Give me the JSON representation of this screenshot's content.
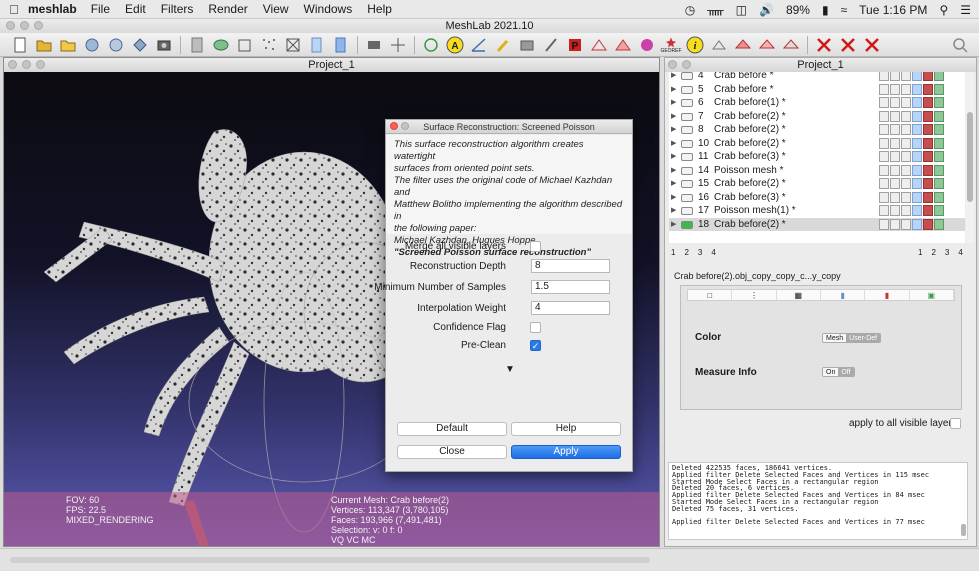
{
  "menubar": {
    "app_name": "meshlab",
    "menus": [
      "File",
      "Edit",
      "Filters",
      "Render",
      "View",
      "Windows",
      "Help"
    ],
    "battery": "89%",
    "clock": "Tue 1:16 PM"
  },
  "window": {
    "title": "MeshLab 2021.10"
  },
  "viewport": {
    "title": "Project_1",
    "fov": "FOV: 60",
    "fps": "FPS:   22.5",
    "render_mode": "MIXED_RENDERING",
    "current_mesh": "Current Mesh: Crab before(2)",
    "vertices": "Vertices: 113,347    (3,780,105)",
    "faces": "Faces: 193,966    (7,491,481)",
    "selection": "Selection: v: 0 f: 0",
    "flags": "VQ VC MC"
  },
  "dialog": {
    "title": "Surface Reconstruction: Screened Poisson",
    "desc_lines": [
      "This surface reconstruction algorithm creates watertight",
      "surfaces from oriented point sets.",
      "The filter uses the original code of Michael Kazhdan and",
      "Matthew Bolitho implementing the algorithm described in",
      "the following paper:",
      "Michael Kazhdan, Hugues Hoppe,"
    ],
    "desc_bold": "\"Screened Poisson surface reconstruction\"",
    "params": {
      "merge_label": "Merge all visible layers",
      "depth_label": "Reconstruction Depth",
      "depth_value": "8",
      "samples_label": "Minimum Number of Samples",
      "samples_value": "1.5",
      "weight_label": "Interpolation Weight",
      "weight_value": "4",
      "confidence_label": "Confidence Flag",
      "preclean_label": "Pre-Clean"
    },
    "expander": "▼",
    "buttons": {
      "default": "Default",
      "help": "Help",
      "close": "Close",
      "apply": "Apply"
    }
  },
  "layer_panel": {
    "title": "Project_1",
    "layers": [
      {
        "num": "4",
        "name": "Crab before *"
      },
      {
        "num": "5",
        "name": "Crab before *"
      },
      {
        "num": "6",
        "name": "Crab before(1) *"
      },
      {
        "num": "7",
        "name": "Crab before(2) *"
      },
      {
        "num": "8",
        "name": "Crab before(2) *"
      },
      {
        "num": "10",
        "name": "Crab before(2) *"
      },
      {
        "num": "11",
        "name": "Crab before(3) *"
      },
      {
        "num": "14",
        "name": "Poisson mesh *"
      },
      {
        "num": "15",
        "name": "Crab before(2) *"
      },
      {
        "num": "16",
        "name": "Crab before(3) *"
      },
      {
        "num": "17",
        "name": "Poisson mesh(1) *"
      },
      {
        "num": "18",
        "name": "Crab before(2) *"
      }
    ],
    "pages_left": [
      "1",
      "2",
      "3",
      "4"
    ],
    "pages_right": [
      "1",
      "2",
      "3",
      "4"
    ],
    "layer_full_name": "Crab before(2).obj_copy_copy_c...y_copy",
    "decor": {
      "color_label": "Color",
      "color_mesh": "Mesh",
      "color_userdef": "User-Def",
      "measure_label": "Measure Info",
      "measure_on": "On",
      "measure_off": "Off"
    },
    "apply_all_label": "apply to all visible layers",
    "log": [
      "Deleted 422535 faces, 186641 vertices.",
      "Applied filter Delete Selected Faces and Vertices in 115 msec",
      "Started Mode Select Faces in a rectangular region",
      "Deleted 20 faces, 6 vertices.",
      "Applied filter Delete Selected Faces and Vertices in 84 msec",
      "Started Mode Select Faces in a rectangular region",
      "Deleted 75 faces, 31 vertices.",
      "",
      "Applied filter Delete Selected Faces and Vertices in 77 msec"
    ]
  },
  "toolbar": {
    "annotation_label": "GEOREF"
  }
}
